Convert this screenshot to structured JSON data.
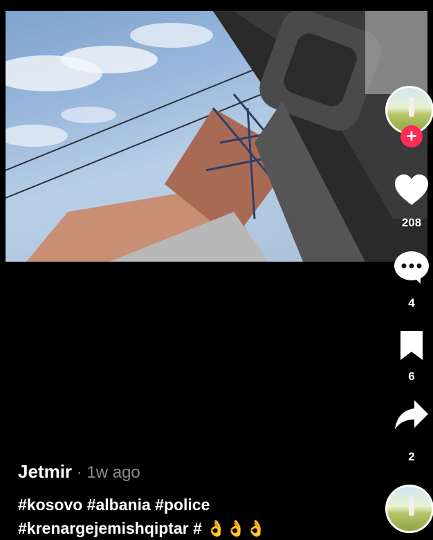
{
  "video": {
    "description_icon": "video-still"
  },
  "creator": {
    "follow_label": "+"
  },
  "actions": {
    "likes": "208",
    "comments": "4",
    "saves": "6",
    "shares": "2"
  },
  "post": {
    "author": "Jetmir",
    "separator": " · ",
    "time": "1w ago",
    "caption_line1": "#kosovo #albania #police",
    "caption_line2": "#krenargejemishqiptar # 👌👌👌"
  },
  "colors": {
    "follow_red": "#fe2c55",
    "muted_text": "#8a8a8a"
  }
}
